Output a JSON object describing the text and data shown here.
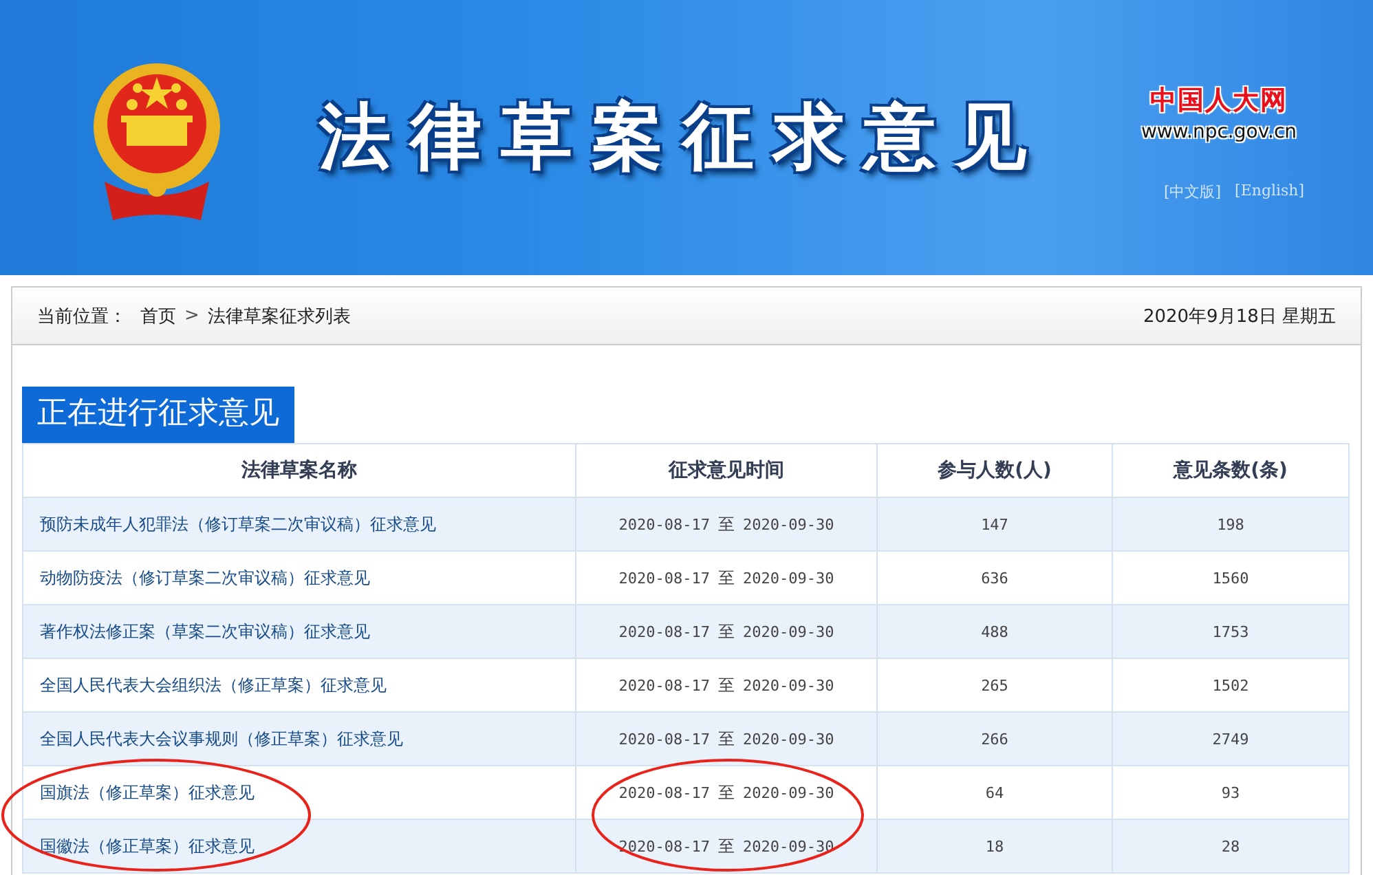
{
  "header": {
    "title": "法律草案征求意见",
    "site_name": "中国人大网",
    "site_url": "www.npc.gov.cn",
    "language_links": [
      "[中文版]",
      "[English]"
    ]
  },
  "breadcrumb": {
    "label": "当前位置：",
    "items": [
      "首页",
      "法律草案征求列表"
    ],
    "separator": ">",
    "date": "2020年9月18日 星期五"
  },
  "section_title": "正在进行征求意见",
  "table": {
    "columns": [
      "法律草案名称",
      "征求意见时间",
      "参与人数(人)",
      "意见条数(条)"
    ],
    "rows": [
      {
        "name": "预防未成年人犯罪法（修订草案二次审议稿）征求意见",
        "start": "2020-08-17",
        "to": "至",
        "end": "2020-09-30",
        "participants": "147",
        "comments": "198",
        "circled": false
      },
      {
        "name": "动物防疫法（修订草案二次审议稿）征求意见",
        "start": "2020-08-17",
        "to": "至",
        "end": "2020-09-30",
        "participants": "636",
        "comments": "1560",
        "circled": false
      },
      {
        "name": "著作权法修正案（草案二次审议稿）征求意见",
        "start": "2020-08-17",
        "to": "至",
        "end": "2020-09-30",
        "participants": "488",
        "comments": "1753",
        "circled": false
      },
      {
        "name": "全国人民代表大会组织法（修正草案）征求意见",
        "start": "2020-08-17",
        "to": "至",
        "end": "2020-09-30",
        "participants": "265",
        "comments": "1502",
        "circled": false
      },
      {
        "name": "全国人民代表大会议事规则（修正草案）征求意见",
        "start": "2020-08-17",
        "to": "至",
        "end": "2020-09-30",
        "participants": "266",
        "comments": "2749",
        "circled": false
      },
      {
        "name": "国旗法（修正草案）征求意见",
        "start": "2020-08-17",
        "to": "至",
        "end": "2020-09-30",
        "participants": "64",
        "comments": "93",
        "circled": true
      },
      {
        "name": "国徽法（修正草案）征求意见",
        "start": "2020-08-17",
        "to": "至",
        "end": "2020-09-30",
        "participants": "18",
        "comments": "28",
        "circled": true
      }
    ]
  }
}
